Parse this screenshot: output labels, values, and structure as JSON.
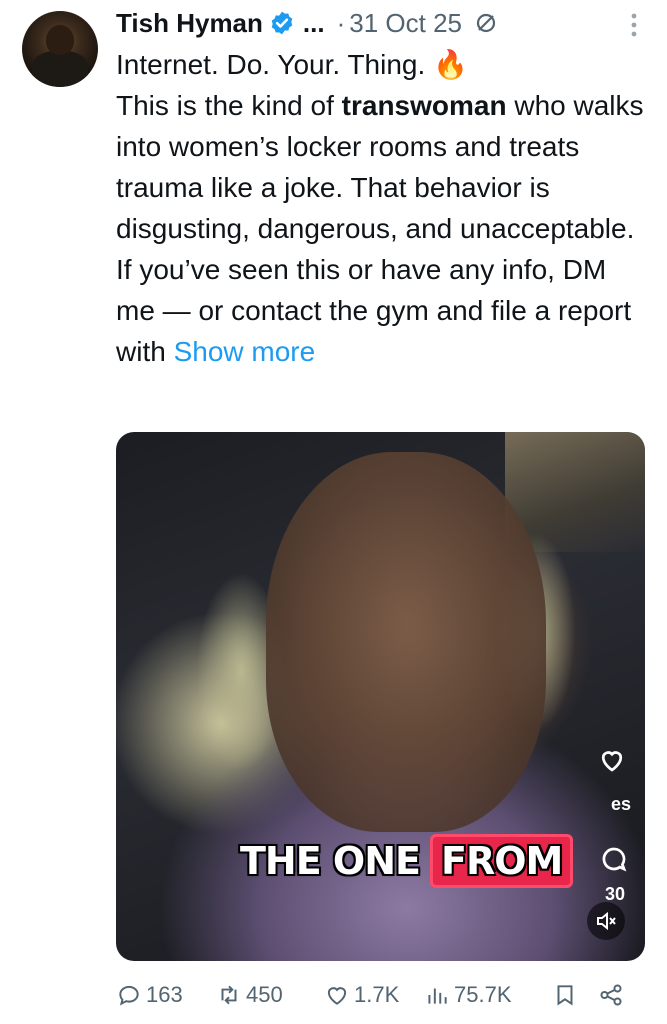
{
  "author": {
    "name": "Tish Hyman",
    "truncation": "...",
    "separator": "·",
    "date": "31 Oct 25"
  },
  "tweet": {
    "line1": "Internet. Do. Your. Thing. ",
    "emoji": "🔥",
    "pre_bold": "This is the kind of ",
    "bold": "transwoman",
    "post_bold": " who walks into women’s locker rooms and treats trauma like a joke. That behavior is disgusting, dangerous, and unacceptable. If you’ve seen this or have any info, DM me — or contact the gym and file a report with ",
    "show_more": "Show more"
  },
  "video": {
    "caption_part1": "THE ONE",
    "caption_part2": "FROM",
    "side_text": "es",
    "side_count": "30"
  },
  "actions": {
    "replies": "163",
    "reposts": "450",
    "likes": "1.7K",
    "views": "75.7K"
  },
  "colors": {
    "link": "#1d9bf0",
    "muted": "#536471",
    "verified": "#1d9bf0",
    "caption_highlight": "#e8264b"
  },
  "icons": [
    "verified-badge-icon",
    "no-replies-icon",
    "more-options-icon",
    "reply-icon",
    "repost-icon",
    "like-icon",
    "views-icon",
    "bookmark-icon",
    "share-icon",
    "mute-icon"
  ]
}
